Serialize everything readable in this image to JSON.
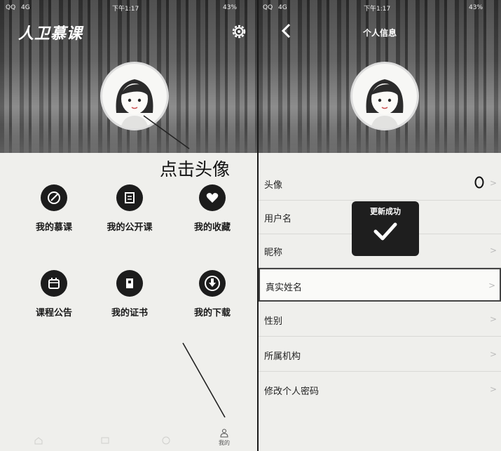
{
  "left": {
    "status": {
      "carrier": "QQ",
      "signal": "4G",
      "time": "下午1:17",
      "battery": "43%"
    },
    "app_name": "人卫慕课",
    "annotation": "点击头像",
    "menu": [
      {
        "label": "我的慕课",
        "icon": "compass-icon"
      },
      {
        "label": "我的公开课",
        "icon": "book-icon"
      },
      {
        "label": "我的收藏",
        "icon": "heart-icon"
      },
      {
        "label": "课程公告",
        "icon": "calendar-icon"
      },
      {
        "label": "我的证书",
        "icon": "certificate-icon"
      },
      {
        "label": "我的下载",
        "icon": "download-icon"
      }
    ],
    "tabbar": {
      "mine_label": "我的"
    }
  },
  "right": {
    "status": {
      "carrier": "QQ",
      "signal": "4G",
      "time": "下午1:17",
      "battery": "43%"
    },
    "title": "个人信息",
    "rows": [
      {
        "label": "头像"
      },
      {
        "label": "用户名"
      },
      {
        "label": "昵称"
      },
      {
        "label": "真实姓名"
      },
      {
        "label": "性别"
      },
      {
        "label": "所属机构"
      },
      {
        "label": "修改个人密码"
      }
    ],
    "toast": {
      "text": "更新成功"
    }
  }
}
